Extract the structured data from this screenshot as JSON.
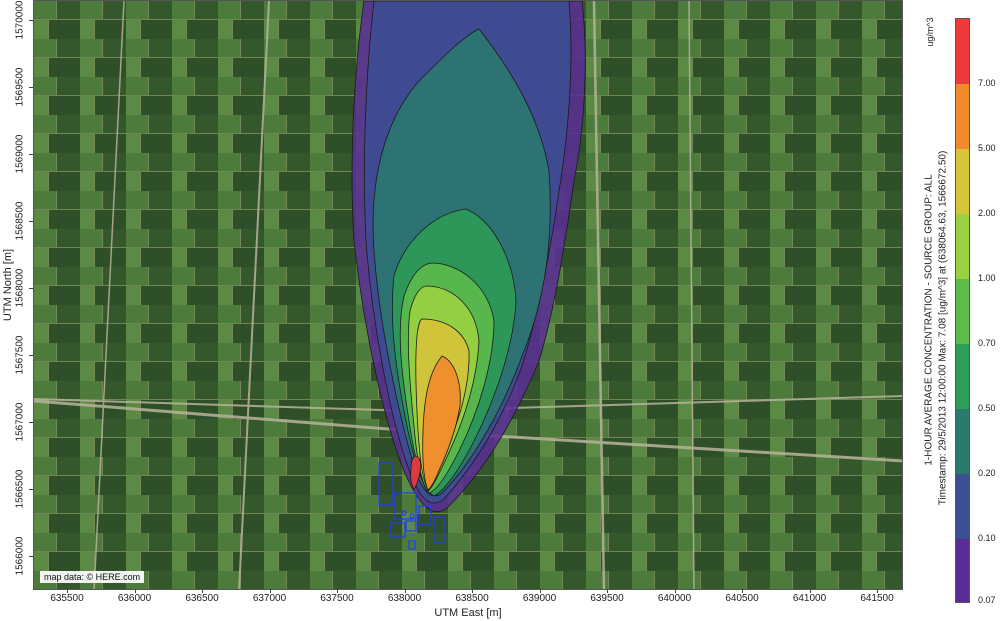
{
  "map": {
    "x_axis_title": "UTM East [m]",
    "y_axis_title": "UTM North [m]",
    "x_ticks": [
      "635500",
      "636000",
      "636500",
      "637000",
      "637500",
      "638000",
      "638500",
      "639000",
      "639500",
      "640000",
      "640500",
      "641000",
      "641500"
    ],
    "y_ticks": [
      "1570000",
      "1569500",
      "1569000",
      "1568500",
      "1568000",
      "1567500",
      "1567000",
      "1566500",
      "1566000"
    ],
    "attribution": "map data: © HERE.com",
    "basemap": "satellite-imagery-farmland",
    "source_marker_color": "#1f3bff"
  },
  "legend": {
    "unit": "ug/m^3",
    "levels": [
      {
        "value": "7.00",
        "color": "#ee3a3a"
      },
      {
        "value": "5.00",
        "color": "#f08a2c"
      },
      {
        "value": "2.00",
        "color": "#d6c43a"
      },
      {
        "value": "1.00",
        "color": "#9bd041"
      },
      {
        "value": "0.70",
        "color": "#5dbb4a"
      },
      {
        "value": "0.50",
        "color": "#2e9e56"
      },
      {
        "value": "0.20",
        "color": "#2a7a6e"
      },
      {
        "value": "0.10",
        "color": "#3b4f93"
      },
      {
        "value": "0.07",
        "color": "#5a2d96"
      }
    ]
  },
  "info": {
    "line1": "1-HOUR AVERAGE CONCENTRATION - SOURCE GROUP: ALL",
    "line2": "Timestamp: 29/5/2013 12:00:00  Max: 7.08 [ug/m^3]  at  (638064.63, 1566672.50)"
  }
}
